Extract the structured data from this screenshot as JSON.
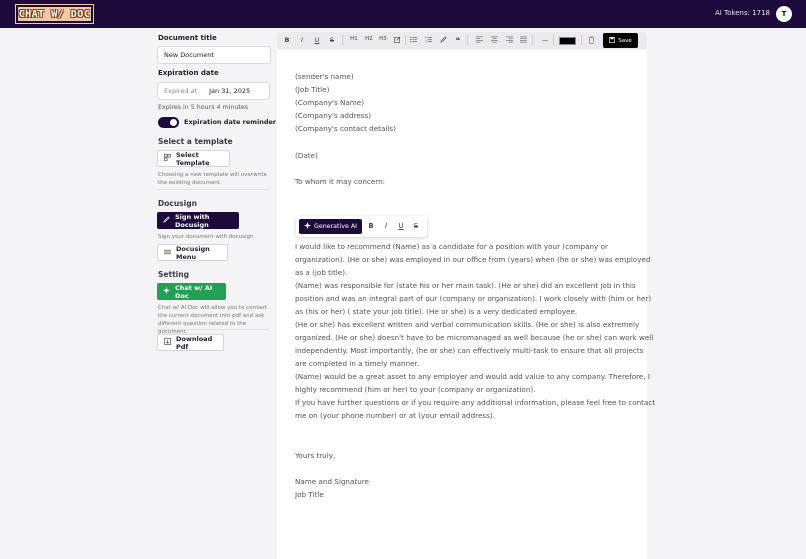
{
  "header": {
    "logo_text": "CHAT W/ DOC",
    "tokens_label": "AI Tokens: 1718",
    "avatar_initial": "T"
  },
  "sidebar": {
    "doc_title_label": "Document title",
    "doc_title_value": "New Document",
    "expiration_label": "Expiration date",
    "expired_at_placeholder": "Expired at",
    "expiration_value": "Jan 31, 2025",
    "expires_in": "Expires in 5 hours 4 minutes",
    "reminder_label": "Expiration date reminder",
    "reminder_on": true,
    "template_section": "Select a template",
    "select_template_btn": "Select Template",
    "template_note": "Choosing a new template will overwrite the existing document.",
    "docusign_section": "Docusign",
    "sign_docusign_btn": "Sign with Docusign",
    "docusign_note": "Sign your document with docusign.",
    "docusign_menu_btn": "Docusign Menu",
    "setting_section": "Setting",
    "chat_ai_btn": "Chat w/ AI Doc",
    "chat_note": "Chat w/ AI Doc will allow you to convert the current document into pdf and ask different question related to the document.",
    "download_pdf_btn": "Download Pdf"
  },
  "toolbar": {
    "bold": "B",
    "italic": "I",
    "underline": "U",
    "strike": "S",
    "h1": "H1",
    "h2": "H2",
    "h3": "H3",
    "quote": "❝",
    "hr": "—",
    "text_color": "#000000",
    "save_label": "Save"
  },
  "floating_toolbar": {
    "generative_ai": "Generative AI",
    "bold": "B",
    "italic": "I",
    "underline": "U",
    "strike": "S"
  },
  "document": {
    "header_lines": [
      "(sender's name)",
      "(Job Title)",
      "(Company's Name)",
      "(Company's address)",
      "(Company's contact details)"
    ],
    "date": "(Date)",
    "salutation": "To whom it may concern:",
    "body_lines": [
      "I would like to recommend (Name) as a candidate for a position with your (company or",
      "organization). (He or she) was employed in our office from (years) when (he or she) was employed",
      "as a (job title).",
      "(Name) was responsible for (state his or her main task). (He or she) did an excellent job in this",
      "position and was an integral part of our (company or organization). I work closely with (him or her)",
      "as (his or her) ( state your job title). (He or she) is a very dedicated employee.",
      "(He or she) has excellent written and verbal communication skills. (He or she) is also extremely",
      "organized. (He or she) doesn't have to be micromanaged as well because (he or she) can work well",
      "independently. Most importantly, (he or she) can effectively multi-task to ensure that all projects",
      "are completed in a timely manner.",
      "(Name) would be a great asset to any employer and would add value to any company. Therefore, I",
      "highly recommend (him or her) to your (company or organization).",
      "If you have further questions or if you require any additional information, please feel free to contact",
      "me on (your phone number) or at (your email address)."
    ],
    "closing": "Yours truly,",
    "signature_lines": [
      "Name and Signature",
      "Job Title"
    ]
  }
}
